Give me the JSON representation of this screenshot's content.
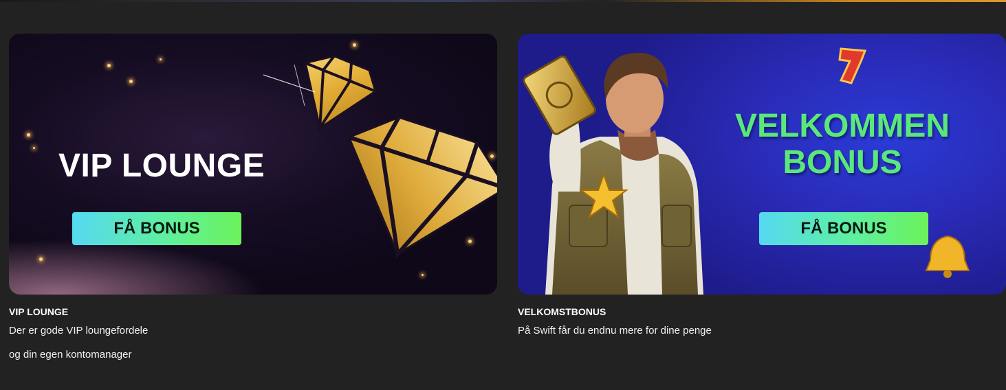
{
  "promos": [
    {
      "banner_title": "VIP LOUNGE",
      "cta_label": "FÅ BONUS",
      "caption_title": "VIP LOUNGE",
      "caption_lines": [
        "Der er gode VIP loungefordele",
        "og din egen kontomanager"
      ]
    },
    {
      "banner_title_lines": [
        "VELKOMMEN",
        "BONUS"
      ],
      "cta_label": "FÅ BONUS",
      "caption_title": "VELKOMSTBONUS",
      "caption_lines": [
        "På Swift får du endnu mere for dine penge"
      ]
    }
  ],
  "colors": {
    "page_background": "#222222",
    "welcome_title": "#5be87a",
    "cta_gradient_start": "#55d9f2",
    "cta_gradient_end": "#6cf25a",
    "gold": "#e7b640"
  },
  "icons": {
    "vip_art": "gold-diamond-icon",
    "welcome_art": "explorer-character-illustration",
    "decor": [
      "gold-star-icon",
      "red-seven-icon",
      "gold-bell-icon",
      "golden-card-icon"
    ]
  }
}
